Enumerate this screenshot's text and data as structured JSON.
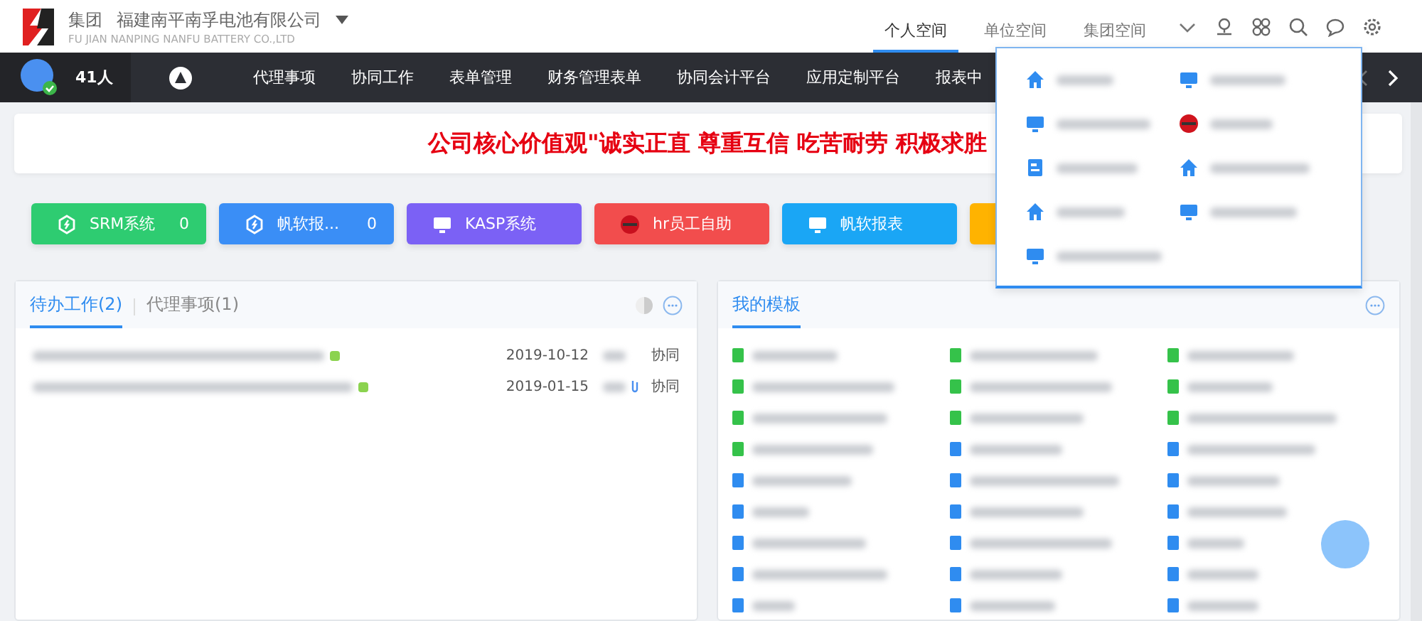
{
  "header": {
    "group": "集团",
    "company": "福建南平南孚电池有限公司",
    "company_en": "FU JIAN NANPING NANFU BATTERY CO.,LTD",
    "spaces": [
      {
        "label": "个人空间",
        "selected": true
      },
      {
        "label": "单位空间",
        "selected": false
      },
      {
        "label": "集团空间",
        "selected": false
      }
    ]
  },
  "navbar": {
    "online": "41人",
    "items": [
      "代理事项",
      "协同工作",
      "表单管理",
      "财务管理表单",
      "协同会计平台",
      "应用定制平台",
      "报表中"
    ]
  },
  "banner": {
    "text": "公司核心价值观\"诚实正直 尊重互信 吃苦耐劳 积极求胜"
  },
  "tiles": [
    {
      "label": "SRM系统",
      "count": "0",
      "color": "#2ecc71",
      "kind": "shield"
    },
    {
      "label": "帆软报...",
      "count": "0",
      "color": "#3a8ef6",
      "kind": "shield"
    },
    {
      "label": "KASP系统",
      "color": "#7b61f5",
      "kind": "monitor"
    },
    {
      "label": "hr员工自助",
      "color": "#f24d4d",
      "kind": "badge"
    },
    {
      "label": "帆软报表",
      "color": "#1aa6f5",
      "kind": "monitor"
    },
    {
      "color": "#ffb300",
      "kind": "blank"
    }
  ],
  "space_menu": [
    {
      "kind": "home"
    },
    {
      "kind": "monitor"
    },
    {
      "kind": "monitor"
    },
    {
      "kind": "badge"
    },
    {
      "kind": "doc"
    },
    {
      "kind": "home"
    },
    {
      "kind": "home"
    },
    {
      "kind": "monitor"
    },
    {
      "kind": "monitor"
    }
  ],
  "todo_panel": {
    "tabs": [
      {
        "label": "待办工作(2)",
        "selected": true
      },
      {
        "label": "代理事项(1)",
        "selected": false
      }
    ],
    "rows": [
      {
        "date": "2019-10-12",
        "type": "协同",
        "attachment": false
      },
      {
        "date": "2019-01-15",
        "type": "协同",
        "attachment": true
      }
    ]
  },
  "template_panel": {
    "title": "我的模板",
    "items": [
      {
        "color": "#35c24a"
      },
      {
        "color": "#35c24a"
      },
      {
        "color": "#35c24a"
      },
      {
        "color": "#35c24a"
      },
      {
        "color": "#35c24a"
      },
      {
        "color": "#35c24a"
      },
      {
        "color": "#35c24a"
      },
      {
        "color": "#35c24a"
      },
      {
        "color": "#35c24a"
      },
      {
        "color": "#35c24a"
      },
      {
        "color": "#2f8cf0"
      },
      {
        "color": "#2f8cf0"
      },
      {
        "color": "#2f8cf0"
      },
      {
        "color": "#2f8cf0"
      },
      {
        "color": "#2f8cf0"
      },
      {
        "color": "#2f8cf0"
      },
      {
        "color": "#2f8cf0"
      },
      {
        "color": "#2f8cf0"
      },
      {
        "color": "#2f8cf0"
      },
      {
        "color": "#2f8cf0"
      },
      {
        "color": "#2f8cf0"
      },
      {
        "color": "#2f8cf0"
      },
      {
        "color": "#2f8cf0"
      },
      {
        "color": "#2f8cf0"
      },
      {
        "color": "#2f8cf0"
      },
      {
        "color": "#2f8cf0"
      },
      {
        "color": "#2f8cf0"
      }
    ]
  }
}
